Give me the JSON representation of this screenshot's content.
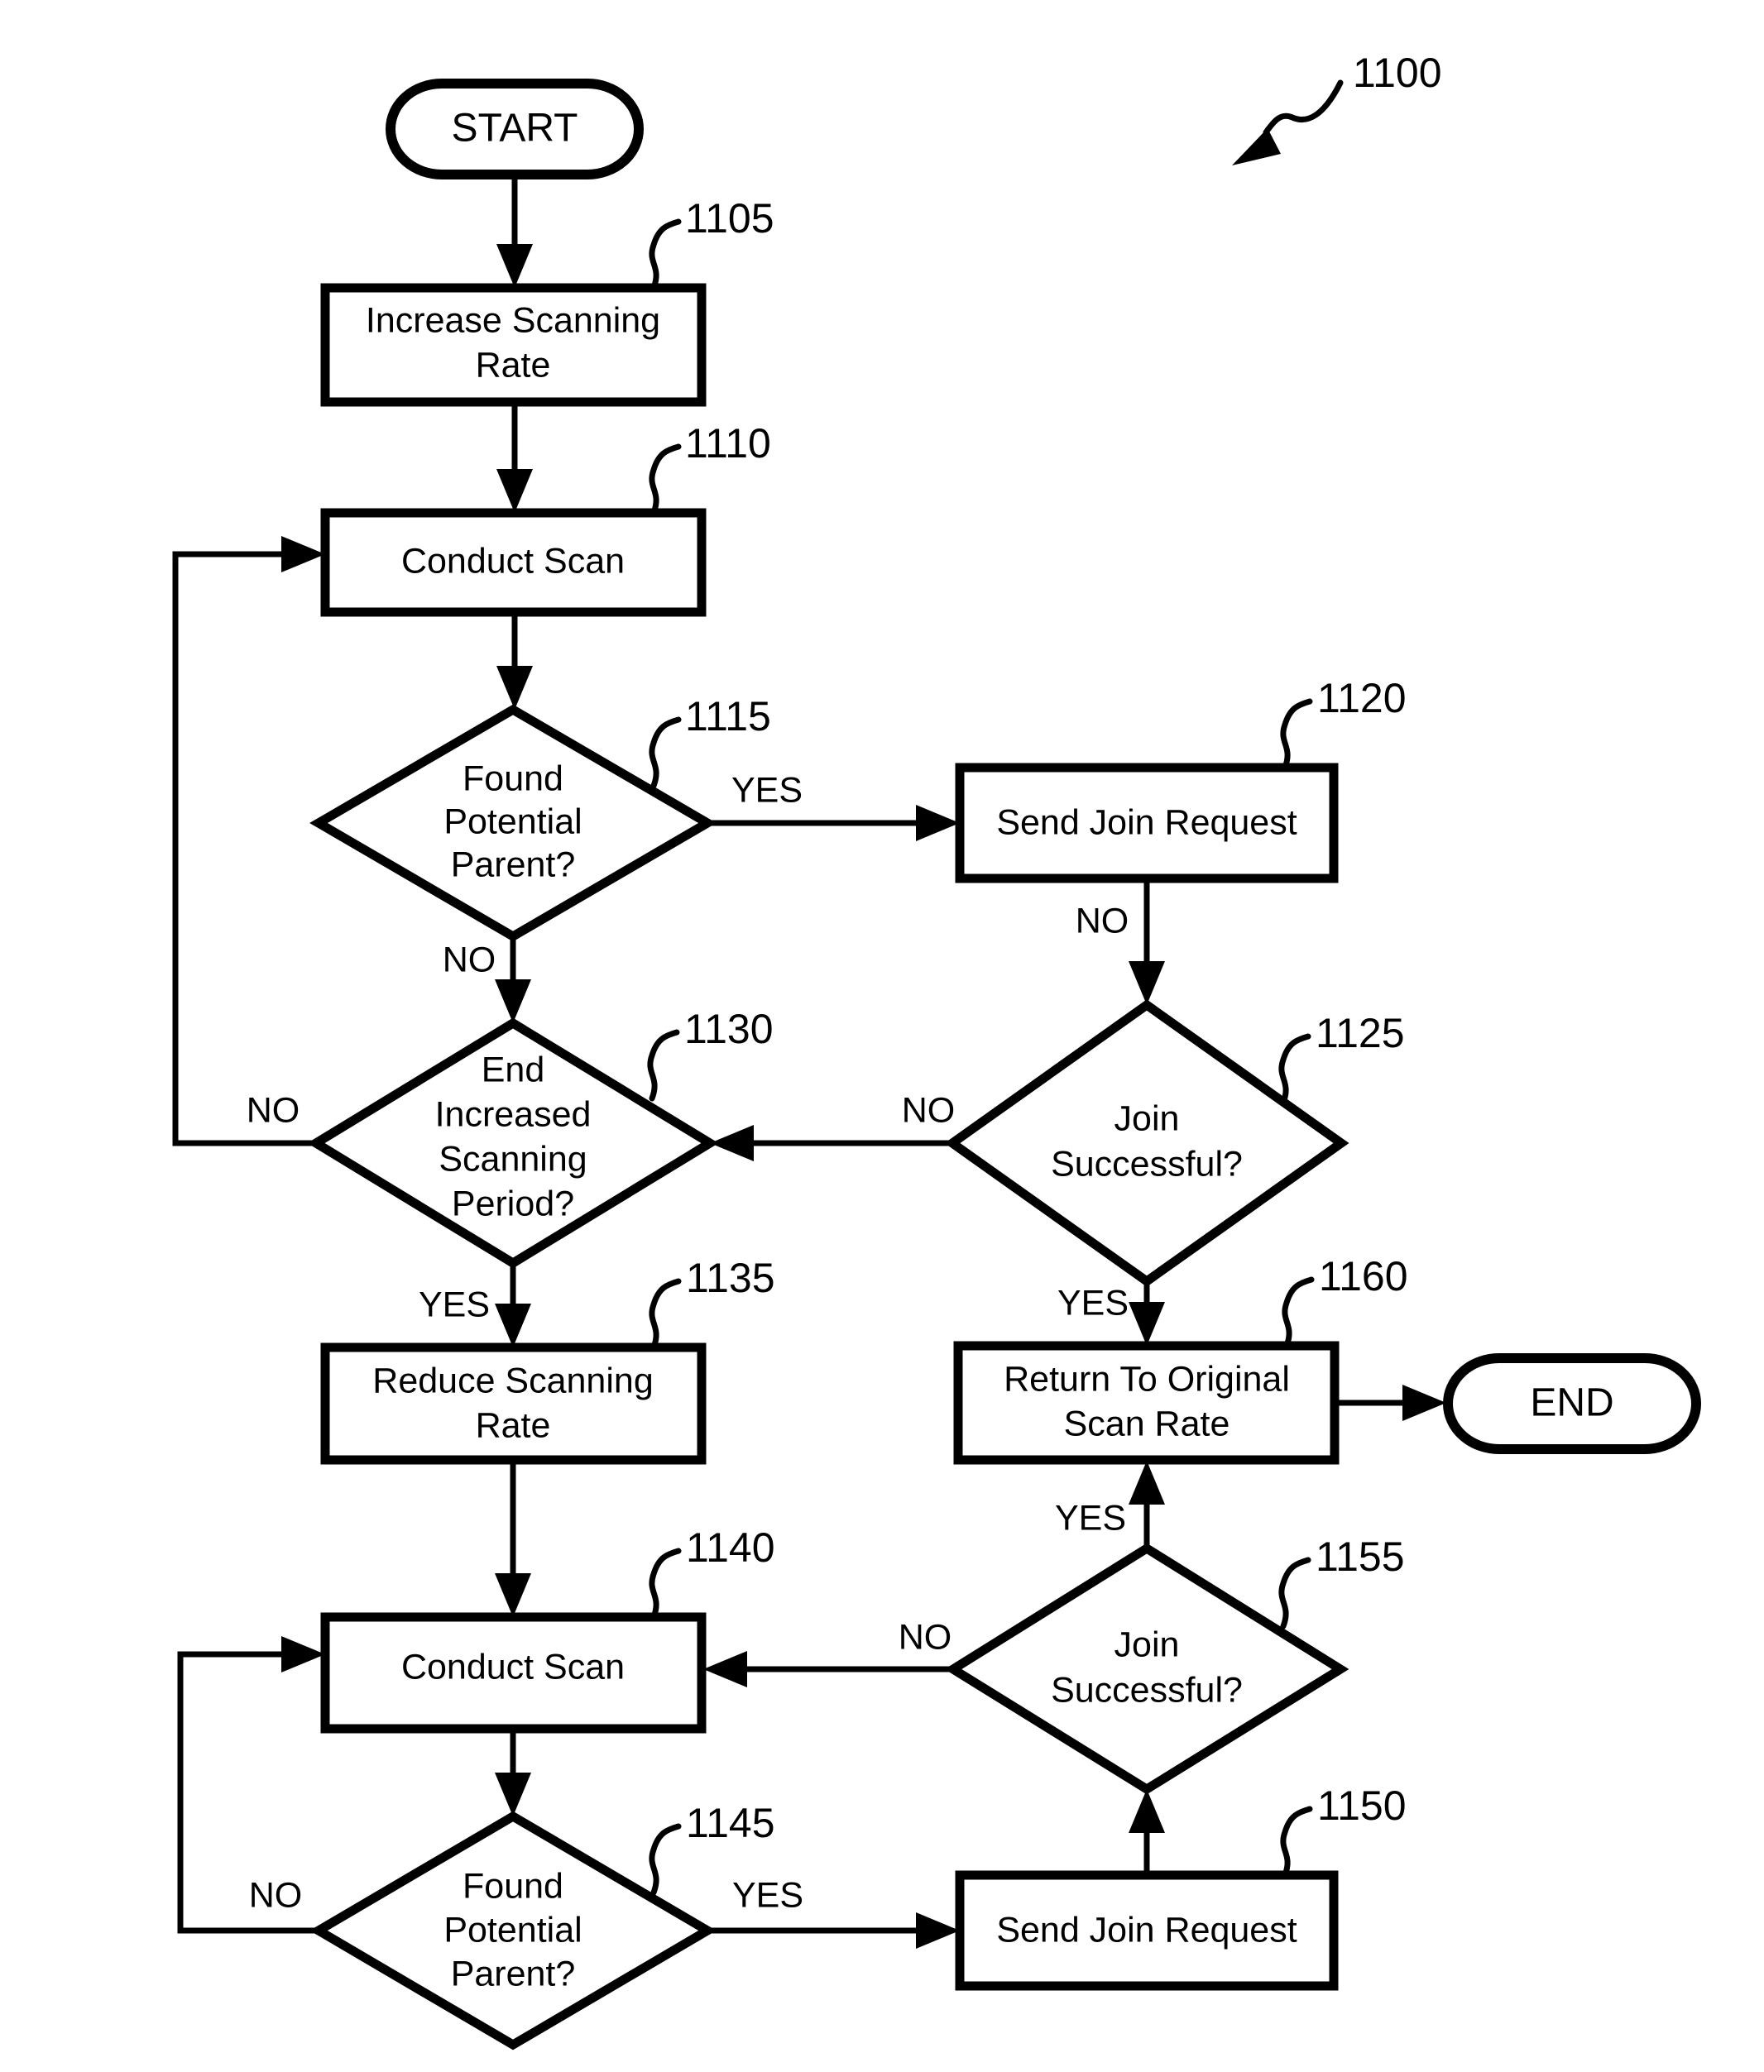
{
  "figure": {
    "figure_ref": "1100",
    "terminators": {
      "start": "START",
      "end": "END"
    },
    "nodes": [
      {
        "id": "1105",
        "ref": "1105",
        "shape": "process",
        "line1": "Increase Scanning",
        "line2": "Rate"
      },
      {
        "id": "1110",
        "ref": "1110",
        "shape": "process",
        "line1": "Conduct Scan",
        "line2": ""
      },
      {
        "id": "1115",
        "ref": "1115",
        "shape": "decision",
        "line1": "Found",
        "line2": "Potential",
        "line3": "Parent?"
      },
      {
        "id": "1120",
        "ref": "1120",
        "shape": "process",
        "line1": "Send Join Request",
        "line2": ""
      },
      {
        "id": "1125",
        "ref": "1125",
        "shape": "decision",
        "line1": "Join",
        "line2": "Successful?",
        "line3": ""
      },
      {
        "id": "1130",
        "ref": "1130",
        "shape": "decision",
        "line1": "End",
        "line2": "Increased",
        "line3": "Scanning",
        "line4": "Period?"
      },
      {
        "id": "1135",
        "ref": "1135",
        "shape": "process",
        "line1": "Reduce Scanning",
        "line2": "Rate"
      },
      {
        "id": "1140",
        "ref": "1140",
        "shape": "process",
        "line1": "Conduct Scan",
        "line2": ""
      },
      {
        "id": "1145",
        "ref": "1145",
        "shape": "decision",
        "line1": "Found",
        "line2": "Potential",
        "line3": "Parent?"
      },
      {
        "id": "1150",
        "ref": "1150",
        "shape": "process",
        "line1": "Send Join Request",
        "line2": ""
      },
      {
        "id": "1155",
        "ref": "1155",
        "shape": "decision",
        "line1": "Join",
        "line2": "Successful?",
        "line3": ""
      },
      {
        "id": "1160",
        "ref": "1160",
        "shape": "process",
        "line1": "Return To Original",
        "line2": "Scan Rate"
      }
    ],
    "edge_labels": {
      "e1115_yes": "YES",
      "e1115_no": "NO",
      "e1120_no": "NO",
      "e1125_no": "NO",
      "e1125_yes": "YES",
      "e1130_no": "NO",
      "e1130_yes": "YES",
      "e1145_no": "NO",
      "e1145_yes": "YES",
      "e1155_no": "NO",
      "e1155_yes": "YES"
    },
    "ref_labels": {
      "r1105": "1105",
      "r1110": "1110",
      "r1115": "1115",
      "r1120": "1120",
      "r1125": "1125",
      "r1130": "1130",
      "r1135": "1135",
      "r1140": "1140",
      "r1145": "1145",
      "r1150": "1150",
      "r1155": "1155",
      "r1160": "1160"
    },
    "colors": {
      "stroke": "#000000",
      "fill": "#ffffff"
    }
  }
}
